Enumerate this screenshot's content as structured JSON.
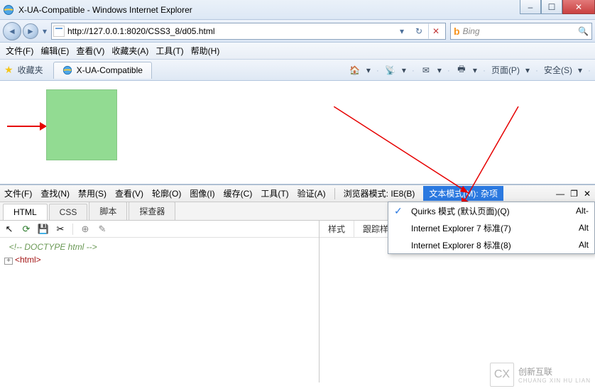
{
  "window": {
    "title": "X-UA-Compatible - Windows Internet Explorer",
    "buttons": {
      "min": "–",
      "max": "☐",
      "close": "✕"
    }
  },
  "nav": {
    "url": "http://127.0.0.1:8020/CSS3_8/d05.html",
    "search_placeholder": "Bing"
  },
  "menubar": [
    "文件(F)",
    "编辑(E)",
    "查看(V)",
    "收藏夹(A)",
    "工具(T)",
    "帮助(H)"
  ],
  "favbar": {
    "favorites": "收藏夹",
    "tab_title": "X-UA-Compatible",
    "tools": {
      "page": "页面(P)",
      "safety": "安全(S)"
    }
  },
  "devtools": {
    "menu": [
      "文件(F)",
      "查找(N)",
      "禁用(S)",
      "查看(V)",
      "轮廓(O)",
      "图像(I)",
      "缓存(C)",
      "工具(T)",
      "验证(A)"
    ],
    "browser_mode_label": "浏览器模式: IE8(B)",
    "doc_mode_label": "文本模式(M): 杂项",
    "tabs": [
      "HTML",
      "CSS",
      "脚本",
      "探查器"
    ],
    "right_tabs": [
      "样式",
      "跟踪样式"
    ],
    "tree": {
      "comment": "<!-- DOCTYPE html -->",
      "html_tag": "<html>"
    },
    "doc_menu": [
      {
        "checked": true,
        "label": "Quirks 模式 (默认页面)(Q)",
        "shortcut": "Alt-"
      },
      {
        "checked": false,
        "label": "Internet Explorer 7 标准(7)",
        "shortcut": "Alt"
      },
      {
        "checked": false,
        "label": "Internet Explorer 8 标准(8)",
        "shortcut": "Alt"
      }
    ]
  },
  "watermark": {
    "cn": "创新互联",
    "en": "CHUANG XIN HU LIAN",
    "logo": "CX"
  }
}
